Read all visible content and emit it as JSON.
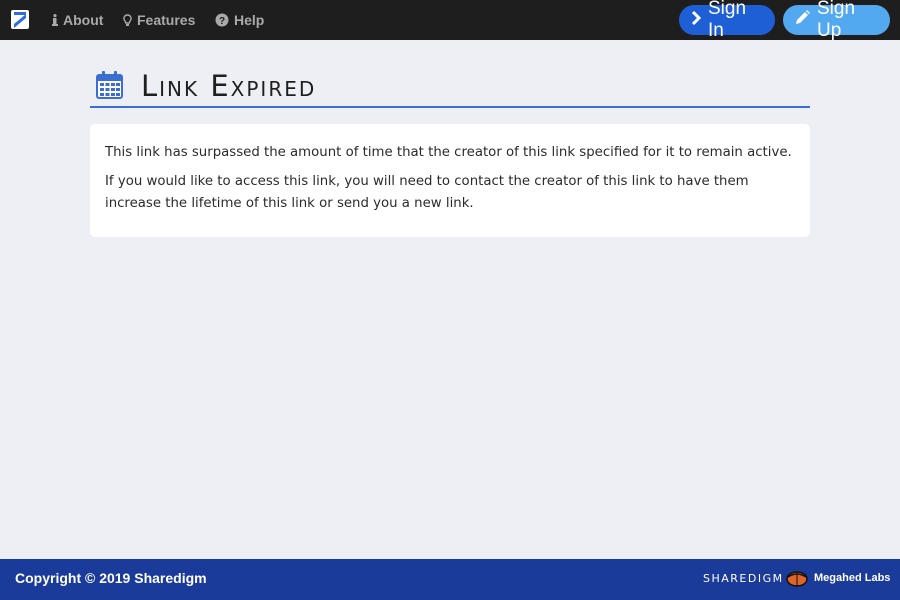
{
  "nav": {
    "logo": "sharedigm-logo-icon",
    "items": [
      {
        "label": "About",
        "icon": "info-icon"
      },
      {
        "label": "Features",
        "icon": "lightbulb-icon"
      },
      {
        "label": "Help",
        "icon": "question-circle-icon"
      }
    ],
    "signin_label": "Sign In",
    "signup_label": "Sign Up"
  },
  "page": {
    "title": "Link Expired",
    "title_icon": "calendar-icon",
    "paragraphs": [
      "This link has surpassed the amount of time that the creator of this link specified for it to remain active.",
      "If you would like to access this link, you will need to contact the creator of this link to have them increase the lifetime of this link or send you a new link."
    ]
  },
  "footer": {
    "copyright": "Copyright © 2019 Sharedigm",
    "brand": "SHAREDIGM",
    "company": "Megahed Labs"
  },
  "colors": {
    "topbar": "#1e1e1e",
    "signin": "#1f5fd6",
    "signup": "#53a9f0",
    "accent": "#3a6fd1",
    "footer": "#1b3b9b"
  }
}
